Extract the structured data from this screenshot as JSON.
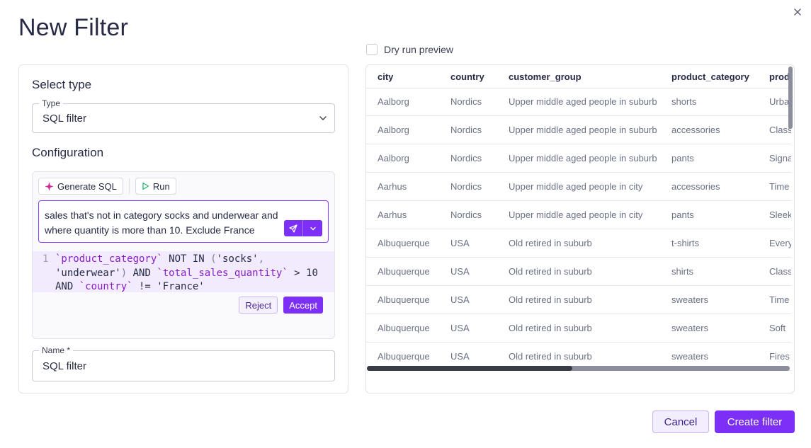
{
  "dialog": {
    "title": "New Filter",
    "close_icon": "close-icon"
  },
  "select_type": {
    "heading": "Select type",
    "type_label": "Type",
    "type_value": "SQL filter"
  },
  "configuration": {
    "heading": "Configuration",
    "generate_sql_label": "Generate SQL",
    "run_label": "Run",
    "prompt_text": "sales that's not in category socks and underwear and where quantity is more than 10. Exclude France",
    "code_line_number": "1",
    "code_tokens": [
      {
        "t": "`product_category`",
        "k": "id"
      },
      {
        "t": " NOT IN ",
        "k": "kw"
      },
      {
        "t": "(",
        "k": "punc"
      },
      {
        "t": "'socks'",
        "k": "str"
      },
      {
        "t": ", ",
        "k": "punc"
      },
      {
        "t": "'underwear'",
        "k": "str"
      },
      {
        "t": ")",
        "k": "punc"
      },
      {
        "t": " AND ",
        "k": "kw"
      },
      {
        "t": "`total_sales_quantity`",
        "k": "id"
      },
      {
        "t": " > 10 AND ",
        "k": "kw"
      },
      {
        "t": "`country`",
        "k": "id"
      },
      {
        "t": " != ",
        "k": "kw"
      },
      {
        "t": "'France'",
        "k": "str"
      }
    ],
    "reject_label": "Reject",
    "accept_label": "Accept"
  },
  "name_field": {
    "label": "Name *",
    "value": "SQL filter"
  },
  "dry_run": {
    "label": "Dry run preview",
    "checked": false
  },
  "table": {
    "columns": [
      "city",
      "country",
      "customer_group",
      "product_category",
      "prod"
    ],
    "rows": [
      [
        "Aalborg",
        "Nordics",
        "Upper middle aged people in suburb",
        "shorts",
        "Urba"
      ],
      [
        "Aalborg",
        "Nordics",
        "Upper middle aged people in suburb",
        "accessories",
        "Class"
      ],
      [
        "Aalborg",
        "Nordics",
        "Upper middle aged people in suburb",
        "pants",
        "Signa"
      ],
      [
        "Aarhus",
        "Nordics",
        "Upper middle aged people in city",
        "accessories",
        "Time"
      ],
      [
        "Aarhus",
        "Nordics",
        "Upper middle aged people in city",
        "pants",
        "Sleek"
      ],
      [
        "Albuquerque",
        "USA",
        "Old retired in suburb",
        "t-shirts",
        "Every"
      ],
      [
        "Albuquerque",
        "USA",
        "Old retired in suburb",
        "shirts",
        "Class"
      ],
      [
        "Albuquerque",
        "USA",
        "Old retired in suburb",
        "sweaters",
        "Time"
      ],
      [
        "Albuquerque",
        "USA",
        "Old retired in suburb",
        "sweaters",
        "Soft"
      ],
      [
        "Albuquerque",
        "USA",
        "Old retired in suburb",
        "sweaters",
        "Fires"
      ]
    ]
  },
  "footer": {
    "cancel_label": "Cancel",
    "create_label": "Create filter"
  },
  "colors": {
    "accent": "#7b2ff7",
    "text": "#262a45"
  }
}
